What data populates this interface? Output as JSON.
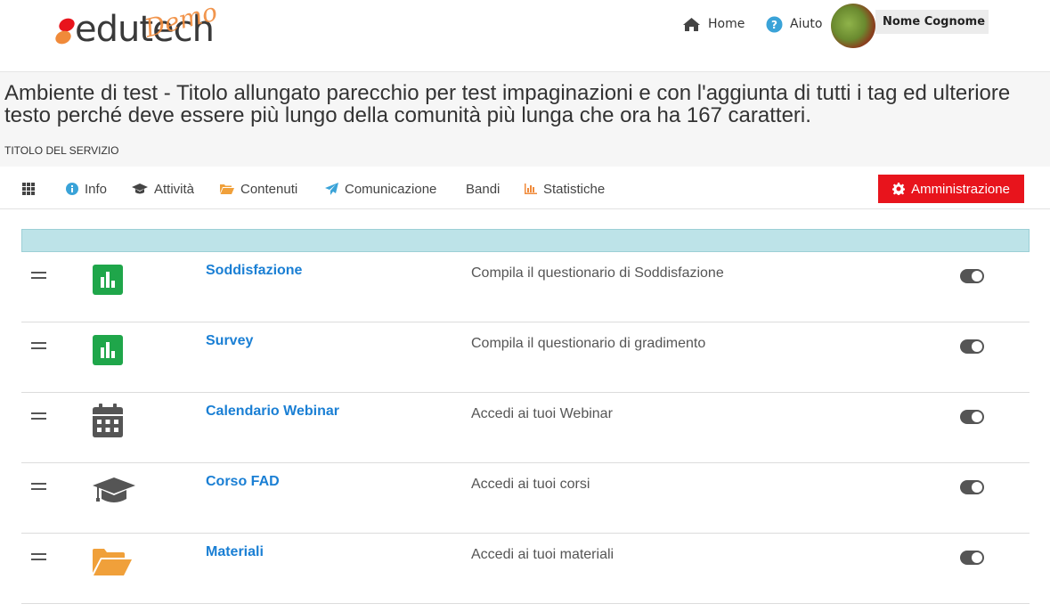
{
  "header": {
    "logo_text": "edutech",
    "logo_badge": "Demo",
    "home_label": "Home",
    "help_label": "Aiuto",
    "user_name": "Nome Cognome"
  },
  "page": {
    "title": "Ambiente di test - Titolo allungato parecchio per test impaginazioni e con l'aggiunta di tutti i tag ed ulteriore testo perché deve essere più lungo della comunità più lunga che ora ha 167 caratteri.",
    "service_title": "TITOLO DEL SERVIZIO"
  },
  "menu": {
    "items": [
      {
        "label": "",
        "icon": "grid-icon"
      },
      {
        "label": "Info",
        "icon": "info-icon"
      },
      {
        "label": "Attività",
        "icon": "graduation-cap-icon"
      },
      {
        "label": "Contenuti",
        "icon": "folder-open-icon"
      },
      {
        "label": "Comunicazione",
        "icon": "send-icon"
      },
      {
        "label": "Bandi",
        "icon": ""
      },
      {
        "label": "Statistiche",
        "icon": "bar-chart-icon"
      }
    ],
    "admin_label": "Amministrazione"
  },
  "colors": {
    "admin": "#e8141c",
    "link": "#1a7fd4",
    "survey_icon": "#1fa64a",
    "folder_icon": "#f0a03a",
    "table_header": "#bde3e8"
  },
  "rows": [
    {
      "name": "Soddisfazione",
      "description": "Compila il questionario di Soddisfazione",
      "icon": "bar-chart-square-icon",
      "enabled": true
    },
    {
      "name": "Survey",
      "description": "Compila il questionario di gradimento",
      "icon": "bar-chart-square-icon",
      "enabled": true
    },
    {
      "name": "Calendario Webinar",
      "description": "Accedi ai tuoi Webinar",
      "icon": "calendar-icon",
      "enabled": true
    },
    {
      "name": "Corso FAD",
      "description": "Accedi ai tuoi corsi",
      "icon": "graduation-cap-icon",
      "enabled": true
    },
    {
      "name": "Materiali",
      "description": "Accedi ai tuoi materiali",
      "icon": "folder-open-icon",
      "enabled": true
    }
  ]
}
